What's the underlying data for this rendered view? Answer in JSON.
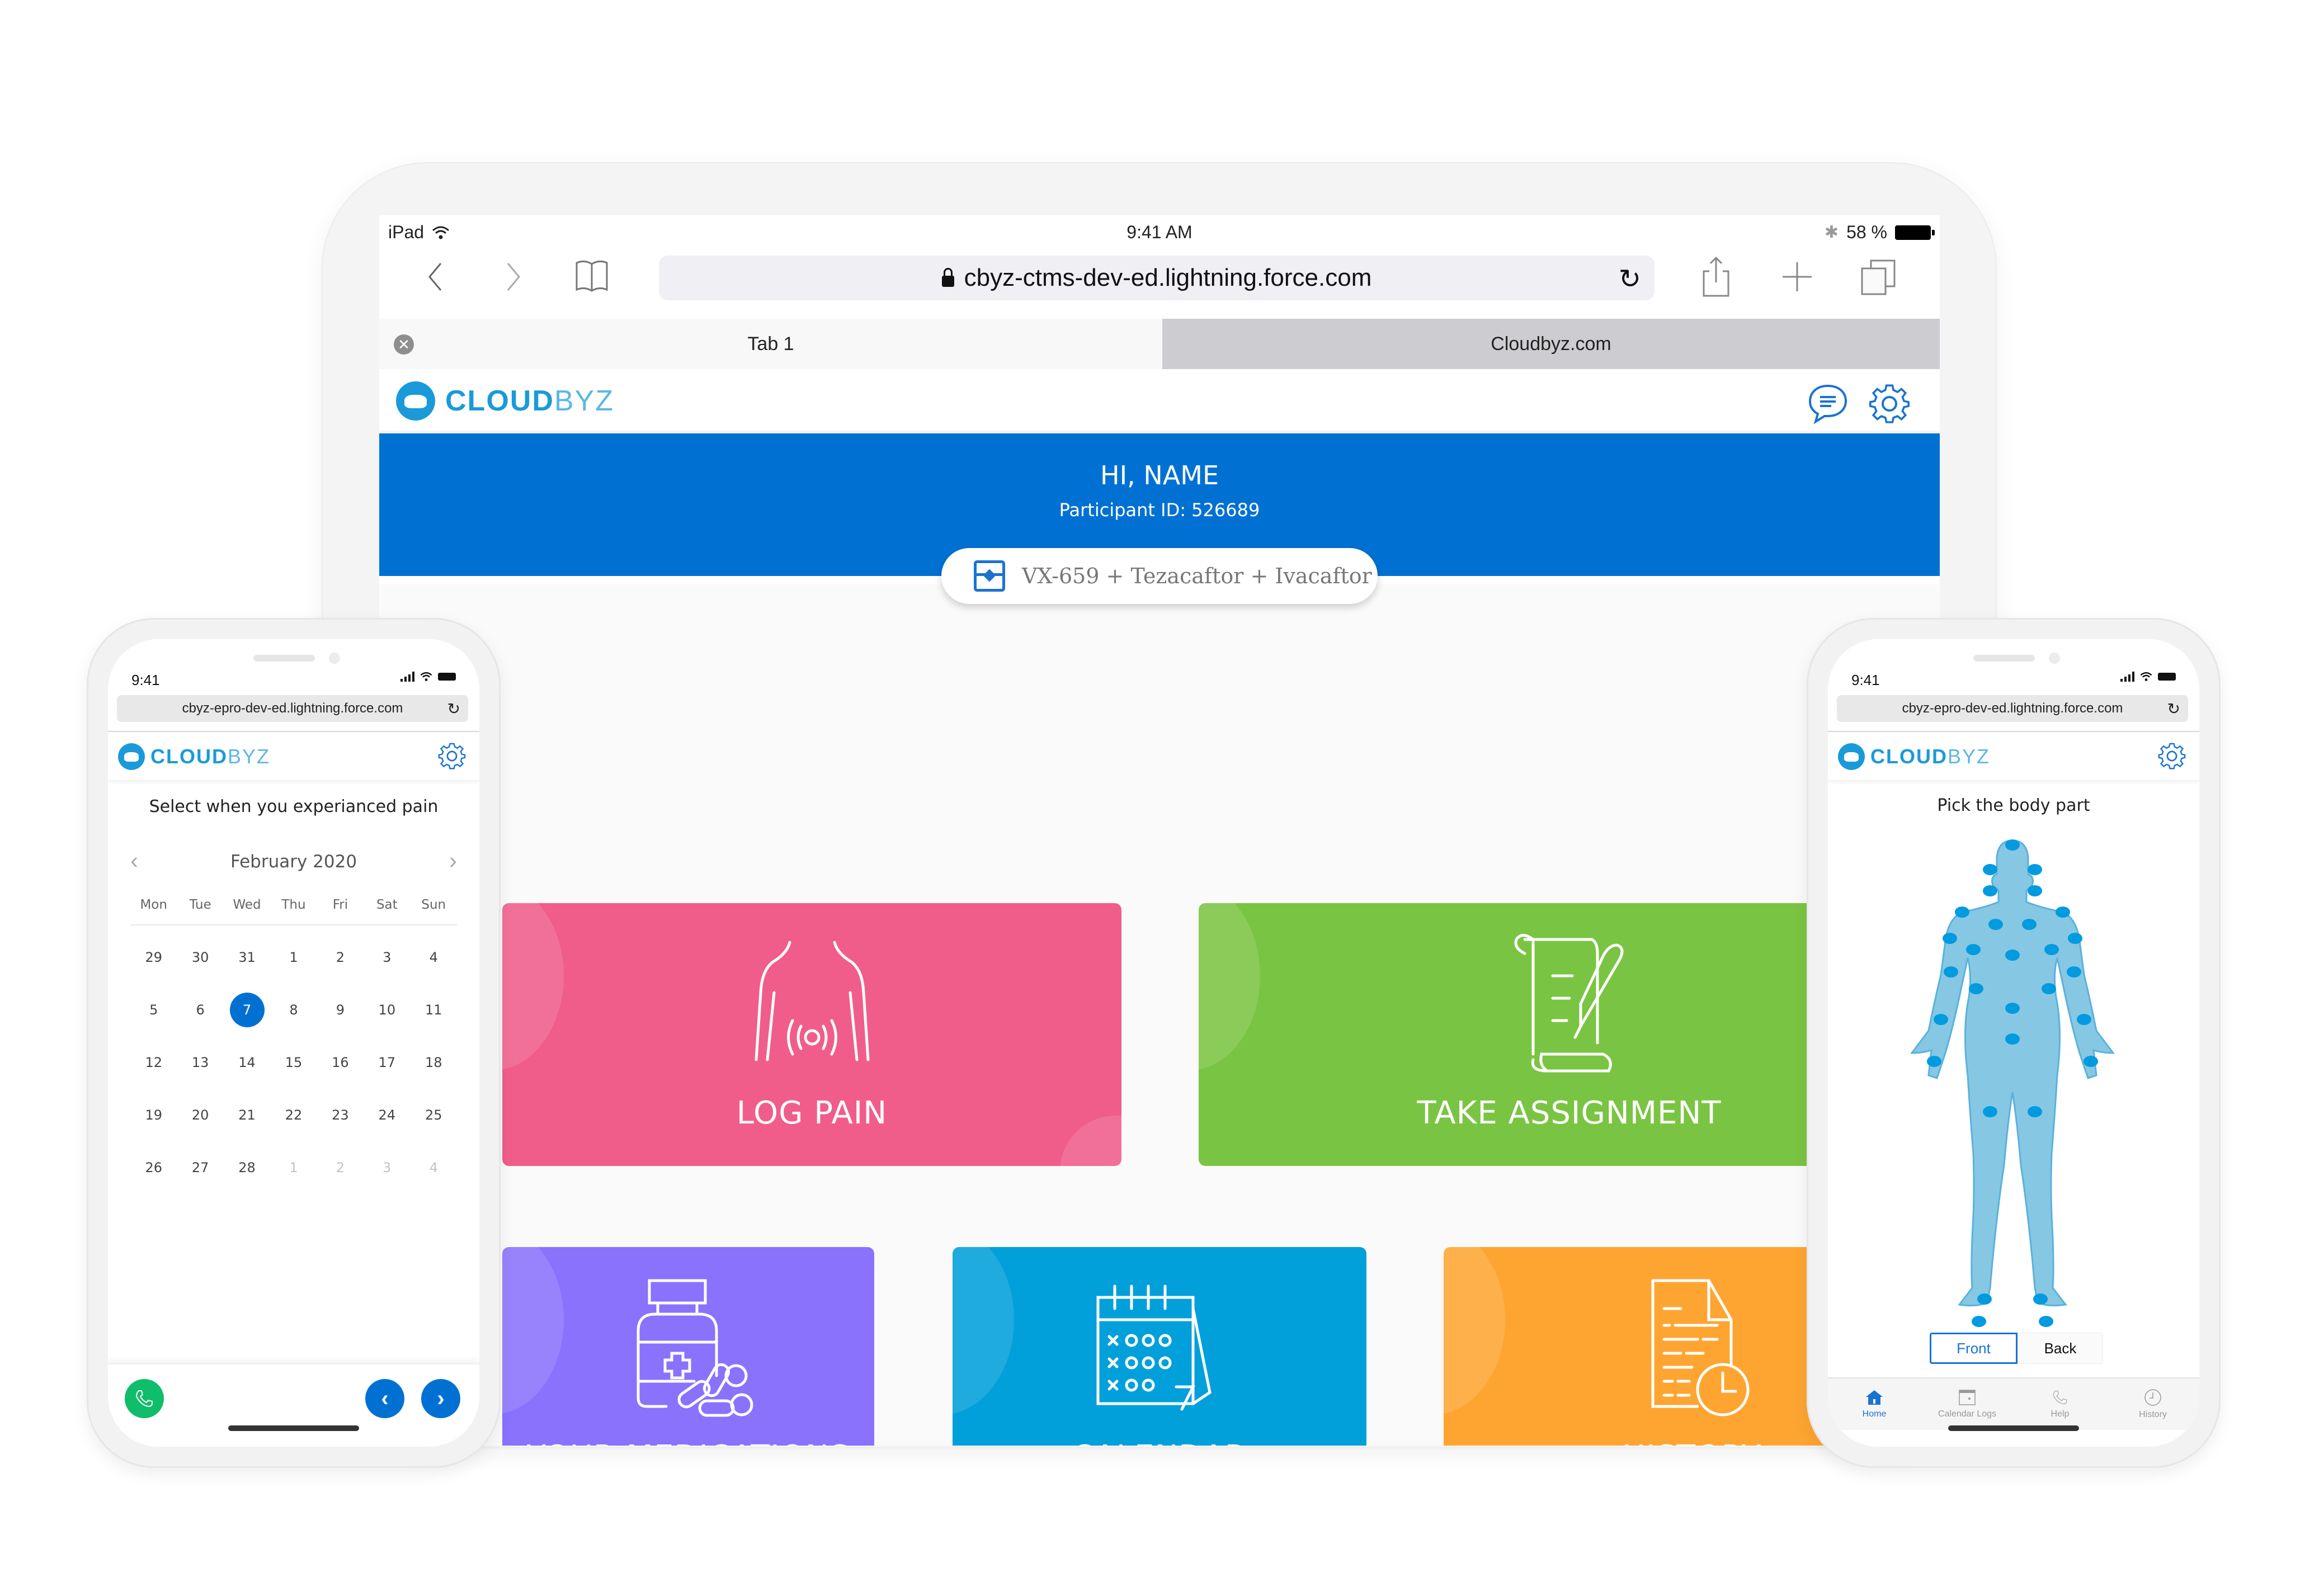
{
  "ipad": {
    "status": {
      "device": "iPad",
      "time": "9:41 AM",
      "battery": "58 %"
    },
    "url": "cbyz-ctms-dev-ed.lightning.force.com",
    "tabs": [
      {
        "label": "Tab 1",
        "active": true
      },
      {
        "label": "Cloudbyz.com",
        "active": false
      }
    ],
    "brand": {
      "bold": "CLOUD",
      "light": "BYZ"
    },
    "welcome": {
      "title": "HI, NAME",
      "participant": "Participant ID: 526689"
    },
    "study": "VX-659 + Tezacaftor + Ivacaftor",
    "tiles": [
      {
        "label": "LOG PAIN",
        "icon": "torso-pain-icon",
        "color": "#f05d8b"
      },
      {
        "label": "TAKE ASSIGNMENT",
        "icon": "scroll-quill-icon",
        "color": "#7ac443"
      },
      {
        "label": "YOUR MEDICATIONS",
        "icon": "medicine-bottle-icon",
        "color": "#8a72fd"
      },
      {
        "label": "CALENDAR",
        "icon": "calendar-icon",
        "color": "#02a0db"
      },
      {
        "label": "HISTORY",
        "icon": "document-clock-icon",
        "color": "#fea531"
      }
    ]
  },
  "phone_left": {
    "time": "9:41",
    "url": "cbyz-epro-dev-ed.lightning.force.com",
    "brand": {
      "bold": "CLOUD",
      "light": "BYZ"
    },
    "prompt": "Select when you experianced pain",
    "calendar": {
      "month": "February 2020",
      "weekdays": [
        "Mon",
        "Tue",
        "Wed",
        "Thu",
        "Fri",
        "Sat",
        "Sun"
      ],
      "weeks": [
        [
          "29",
          "30",
          "31",
          "1",
          "2",
          "3",
          "4"
        ],
        [
          "5",
          "6",
          "7",
          "8",
          "9",
          "10",
          "11"
        ],
        [
          "12",
          "13",
          "14",
          "15",
          "16",
          "17",
          "18"
        ],
        [
          "19",
          "20",
          "21",
          "22",
          "23",
          "24",
          "25"
        ],
        [
          "26",
          "27",
          "28",
          "1",
          "2",
          "3",
          "4"
        ]
      ],
      "selected": "7",
      "muted_last_row_from": 3
    }
  },
  "phone_right": {
    "time": "9:41",
    "url": "cbyz-epro-dev-ed.lightning.force.com",
    "brand": {
      "bold": "CLOUD",
      "light": "BYZ"
    },
    "prompt": "Pick the body part",
    "toggle": {
      "front": "Front",
      "back": "Back",
      "selected": "Front"
    },
    "nav": [
      {
        "label": "Home",
        "icon": "home-icon",
        "active": true
      },
      {
        "label": "Calendar Logs",
        "icon": "calendar-icon",
        "active": false
      },
      {
        "label": "Help",
        "icon": "phone-icon",
        "active": false
      },
      {
        "label": "History",
        "icon": "clock-icon",
        "active": false
      }
    ]
  },
  "colors": {
    "primary": "#0071d3",
    "brand": "#1a9ad9",
    "call": "#0fbd6b",
    "body": "#86c7e3",
    "body_point": "#039be0"
  }
}
